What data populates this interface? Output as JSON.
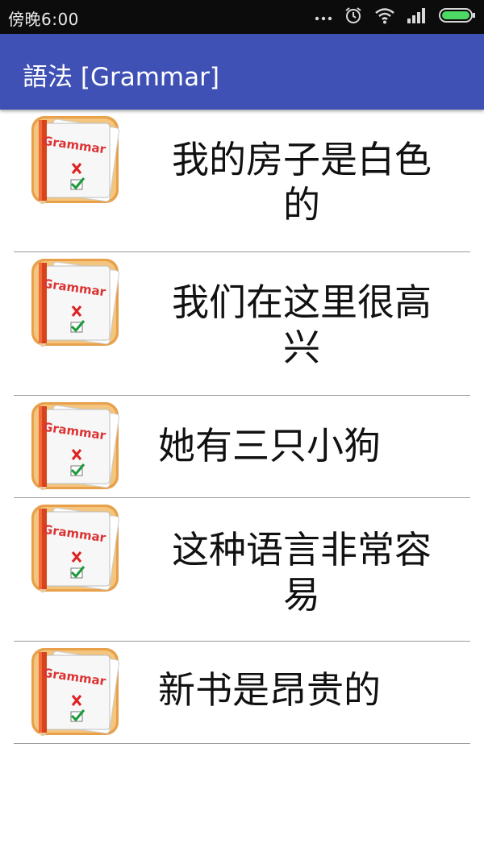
{
  "status_bar": {
    "time": "傍晚6:00",
    "icons": [
      "ellipsis-icon",
      "alarm-icon",
      "wifi-icon",
      "signal-icon",
      "battery-icon"
    ]
  },
  "app_bar": {
    "title": "語法 [Grammar]",
    "color": "#3f51b5"
  },
  "items": [
    {
      "icon": "grammar-icon",
      "icon_text": "Grammar",
      "text": "我的房子是白色的"
    },
    {
      "icon": "grammar-icon",
      "icon_text": "Grammar",
      "text": "我们在这里很高兴"
    },
    {
      "icon": "grammar-icon",
      "icon_text": "Grammar",
      "text": "她有三只小狗"
    },
    {
      "icon": "grammar-icon",
      "icon_text": "Grammar",
      "text": "这种语言非常容易"
    },
    {
      "icon": "grammar-icon",
      "icon_text": "Grammar",
      "text": "新书是昂贵的"
    }
  ]
}
